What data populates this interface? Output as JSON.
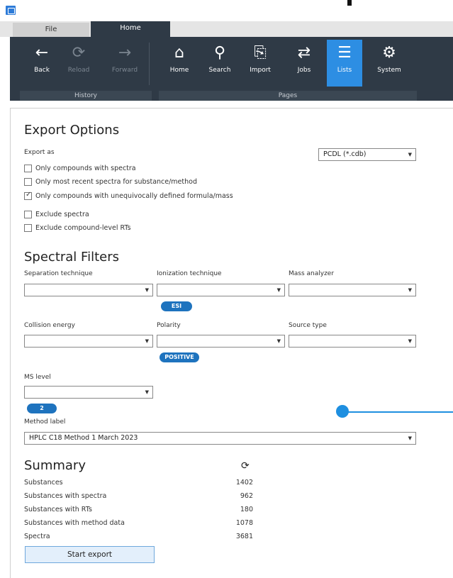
{
  "titlebar": {
    "app_icon": "app-logo-icon"
  },
  "tabs": {
    "file": "File",
    "home": "Home"
  },
  "ribbon": {
    "buttons": [
      {
        "label": "Back",
        "icon": "arrow-left-icon",
        "glyph": "←"
      },
      {
        "label": "Reload",
        "icon": "reload-icon",
        "glyph": "⟳"
      },
      {
        "label": "Forward",
        "icon": "arrow-right-icon",
        "glyph": "→"
      },
      {
        "label": "Home",
        "icon": "home-icon",
        "glyph": "⌂"
      },
      {
        "label": "Search",
        "icon": "search-icon",
        "glyph": "⚲"
      },
      {
        "label": "Import",
        "icon": "import-icon",
        "glyph": "⎘"
      },
      {
        "label": "Jobs",
        "icon": "jobs-icon",
        "glyph": "⇄"
      },
      {
        "label": "Lists",
        "icon": "lists-icon",
        "glyph": "☰"
      },
      {
        "label": "System",
        "icon": "gear-icon",
        "glyph": "⚙"
      }
    ],
    "groups": {
      "history": "History",
      "pages": "Pages"
    }
  },
  "export": {
    "title": "Export Options",
    "export_as_label": "Export as",
    "format_value": "PCDL (*.cdb)",
    "options": [
      {
        "label": "Only compounds with spectra",
        "checked": false
      },
      {
        "label": "Only most recent spectra for substance/method",
        "checked": false
      },
      {
        "label": "Only compounds with unequivocally defined formula/mass",
        "checked": true
      },
      {
        "label": "Exclude spectra",
        "checked": false
      },
      {
        "label": "Exclude compound-level RTs",
        "checked": false
      }
    ]
  },
  "filters": {
    "title": "Spectral Filters",
    "separation_label": "Separation technique",
    "ionization_label": "Ionization technique",
    "mass_analyzer_label": "Mass analyzer",
    "ionization_tag": "ESI",
    "collision_label": "Collision energy",
    "polarity_label": "Polarity",
    "source_type_label": "Source type",
    "polarity_tag": "POSITIVE",
    "ms_level_label": "MS level",
    "ms_level_tag": "2",
    "method_label": "Method label",
    "method_value": "HPLC C18 Method 1 March 2023"
  },
  "summary": {
    "title": "Summary",
    "rows": [
      {
        "label": "Substances",
        "value": "1402"
      },
      {
        "label": "Substances with spectra",
        "value": "962"
      },
      {
        "label": "Substances with RTs",
        "value": "180"
      },
      {
        "label": "Substances with method data",
        "value": "1078"
      },
      {
        "label": "Spectra",
        "value": "3681"
      }
    ],
    "start_button": "Start export"
  },
  "colors": {
    "ribbon": "#2f3a46",
    "accent": "#2d8ee3",
    "pill": "#1e73be"
  }
}
